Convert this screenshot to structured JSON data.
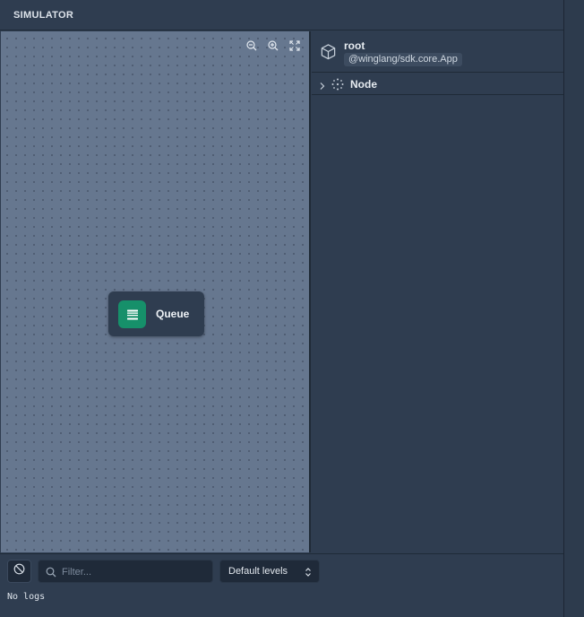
{
  "header": {
    "title": "SIMULATOR"
  },
  "canvas": {
    "controls": [
      {
        "name": "zoom-out-icon"
      },
      {
        "name": "zoom-in-icon"
      },
      {
        "name": "fit-view-icon"
      }
    ],
    "node": {
      "label": "Queue",
      "icon": "queue-icon",
      "color": "#16906a"
    }
  },
  "inspector": {
    "root": {
      "name": "root",
      "type": "@winglang/sdk.core.App",
      "icon": "cube-icon"
    },
    "children": [
      {
        "label": "Node",
        "icon": "node-dots-icon",
        "expanded": false
      }
    ]
  },
  "logs": {
    "clear_icon": "clear-logs-icon",
    "filter_placeholder": "Filter...",
    "filter_value": "",
    "level_selected": "Default levels",
    "empty_text": "No logs"
  },
  "colors": {
    "canvas_bg": "#66778f",
    "panel_bg": "#2f3d50",
    "accent": "#16906a"
  }
}
